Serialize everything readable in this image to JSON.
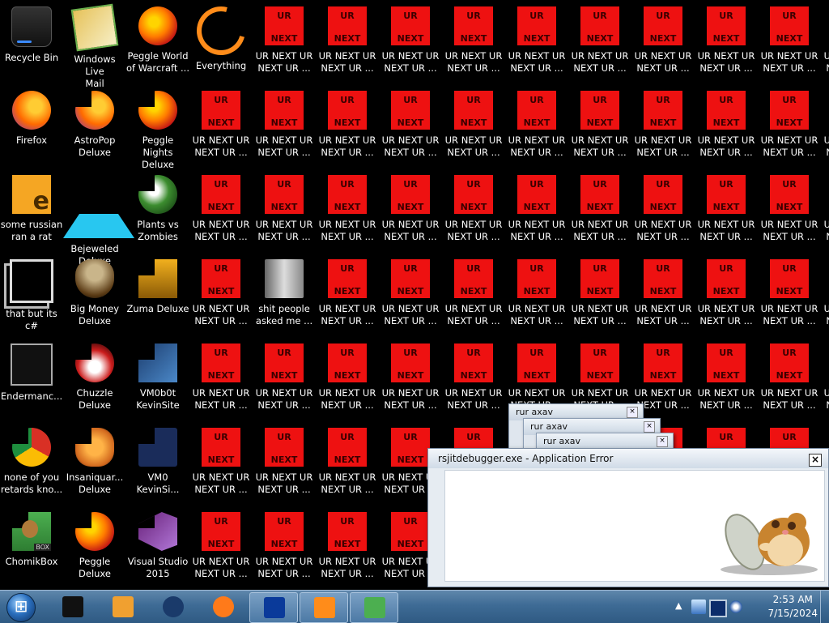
{
  "desktop": {
    "apps": [
      {
        "label": "Recycle Bin",
        "icon": "recycle-bin-icon",
        "cls": "bin",
        "col": 0,
        "row": 0
      },
      {
        "label": "Windows Live\nMail",
        "icon": "windows-live-mail-icon",
        "cls": "mail",
        "col": 1,
        "row": 0
      },
      {
        "label": "Peggle World\nof Warcraft ...",
        "icon": "peggle-world-of-warcraft-icon",
        "cls": "peg",
        "col": 2,
        "row": 0
      },
      {
        "label": "Everything",
        "icon": "everything-search-icon",
        "cls": "ring",
        "col": 3,
        "row": 0
      },
      {
        "label": "Firefox",
        "icon": "firefox-icon",
        "cls": "fox",
        "col": 0,
        "row": 1
      },
      {
        "label": "AstroPop\nDeluxe",
        "icon": "astropop-deluxe-icon",
        "cls": "fox",
        "col": 1,
        "row": 1,
        "masked": true
      },
      {
        "label": "Peggle Nights\nDeluxe",
        "icon": "peggle-nights-deluxe-icon",
        "cls": "peg",
        "col": 2,
        "row": 1,
        "masked": true
      },
      {
        "label": "some russian\nran a rat",
        "icon": "some-russian-ran-a-rat-icon",
        "cls": "mono",
        "col": 0,
        "row": 2
      },
      {
        "label": "Bejeweled\nDeluxe",
        "icon": "bejeweled-deluxe-icon",
        "cls": "jewel",
        "col": 1,
        "row": 2
      },
      {
        "label": "Plants vs\nZombies",
        "icon": "plants-vs-zombies-icon",
        "cls": "plant",
        "col": 2,
        "row": 2,
        "masked": true
      },
      {
        "label": "that but its c#",
        "icon": "that-but-its-csharp-icon",
        "cls": "stack",
        "col": 0,
        "row": 3
      },
      {
        "label": "Big Money\nDeluxe",
        "icon": "big-money-deluxe-icon",
        "cls": "money",
        "col": 1,
        "row": 3
      },
      {
        "label": "Zuma Deluxe",
        "icon": "zuma-deluxe-icon",
        "cls": "zuma",
        "col": 2,
        "row": 3,
        "masked": true
      },
      {
        "label": "shit people\nasked me ...",
        "icon": "folder-icon",
        "cls": "folder",
        "col": 4,
        "row": 3
      },
      {
        "label": "Endermanc...",
        "icon": "endermanch-icon",
        "cls": "ender",
        "col": 0,
        "row": 4
      },
      {
        "label": "Chuzzle\nDeluxe",
        "icon": "chuzzle-deluxe-icon",
        "cls": "chuz",
        "col": 1,
        "row": 4,
        "masked": true
      },
      {
        "label": "VM0b0t\nKevinSite",
        "icon": "vm0b0t-kevinsite-icon",
        "cls": "vm",
        "col": 2,
        "row": 4,
        "masked": true
      },
      {
        "label": "none of you\nretards kno...",
        "icon": "chrome-icon",
        "cls": "chrome",
        "col": 0,
        "row": 5,
        "masked": true
      },
      {
        "label": "Insaniquar...\nDeluxe",
        "icon": "insaniquarium-deluxe-icon",
        "cls": "insan",
        "col": 1,
        "row": 5,
        "masked": true
      },
      {
        "label": "VM0\nKevinSi...",
        "icon": "vm0-kevinsite-icon",
        "cls": "vm0",
        "col": 2,
        "row": 5,
        "masked": true
      },
      {
        "label": "ChomikBox",
        "icon": "chomikbox-icon",
        "cls": "chomik",
        "col": 0,
        "row": 6,
        "masked": true
      },
      {
        "label": "Peggle Deluxe",
        "icon": "peggle-deluxe-icon",
        "cls": "peg",
        "col": 1,
        "row": 6,
        "masked": true
      },
      {
        "label": "Visual Studio\n2015",
        "icon": "visual-studio-2015-icon",
        "cls": "vs",
        "col": 2,
        "row": 6,
        "masked": true
      }
    ],
    "ur_icon": {
      "label": "UR NEXT UR\nNEXT UR ...",
      "top_text": "UR",
      "bottom_text": "NEXT"
    },
    "chomik_badge": "BOX"
  },
  "dialogs": {
    "back_title": "rur axav",
    "main_title": "rsjitdebugger.exe - Application Error",
    "close": "×"
  },
  "taskbar": {
    "apps": [
      "desktop-icon",
      "media-player-icon",
      "globe-icon",
      "firefox-icon",
      "phone-icon",
      "zuma-icon",
      "chomikbox-icon"
    ],
    "tray_arrow": "▲",
    "time": "2:53 AM",
    "date": "7/15/2024"
  }
}
